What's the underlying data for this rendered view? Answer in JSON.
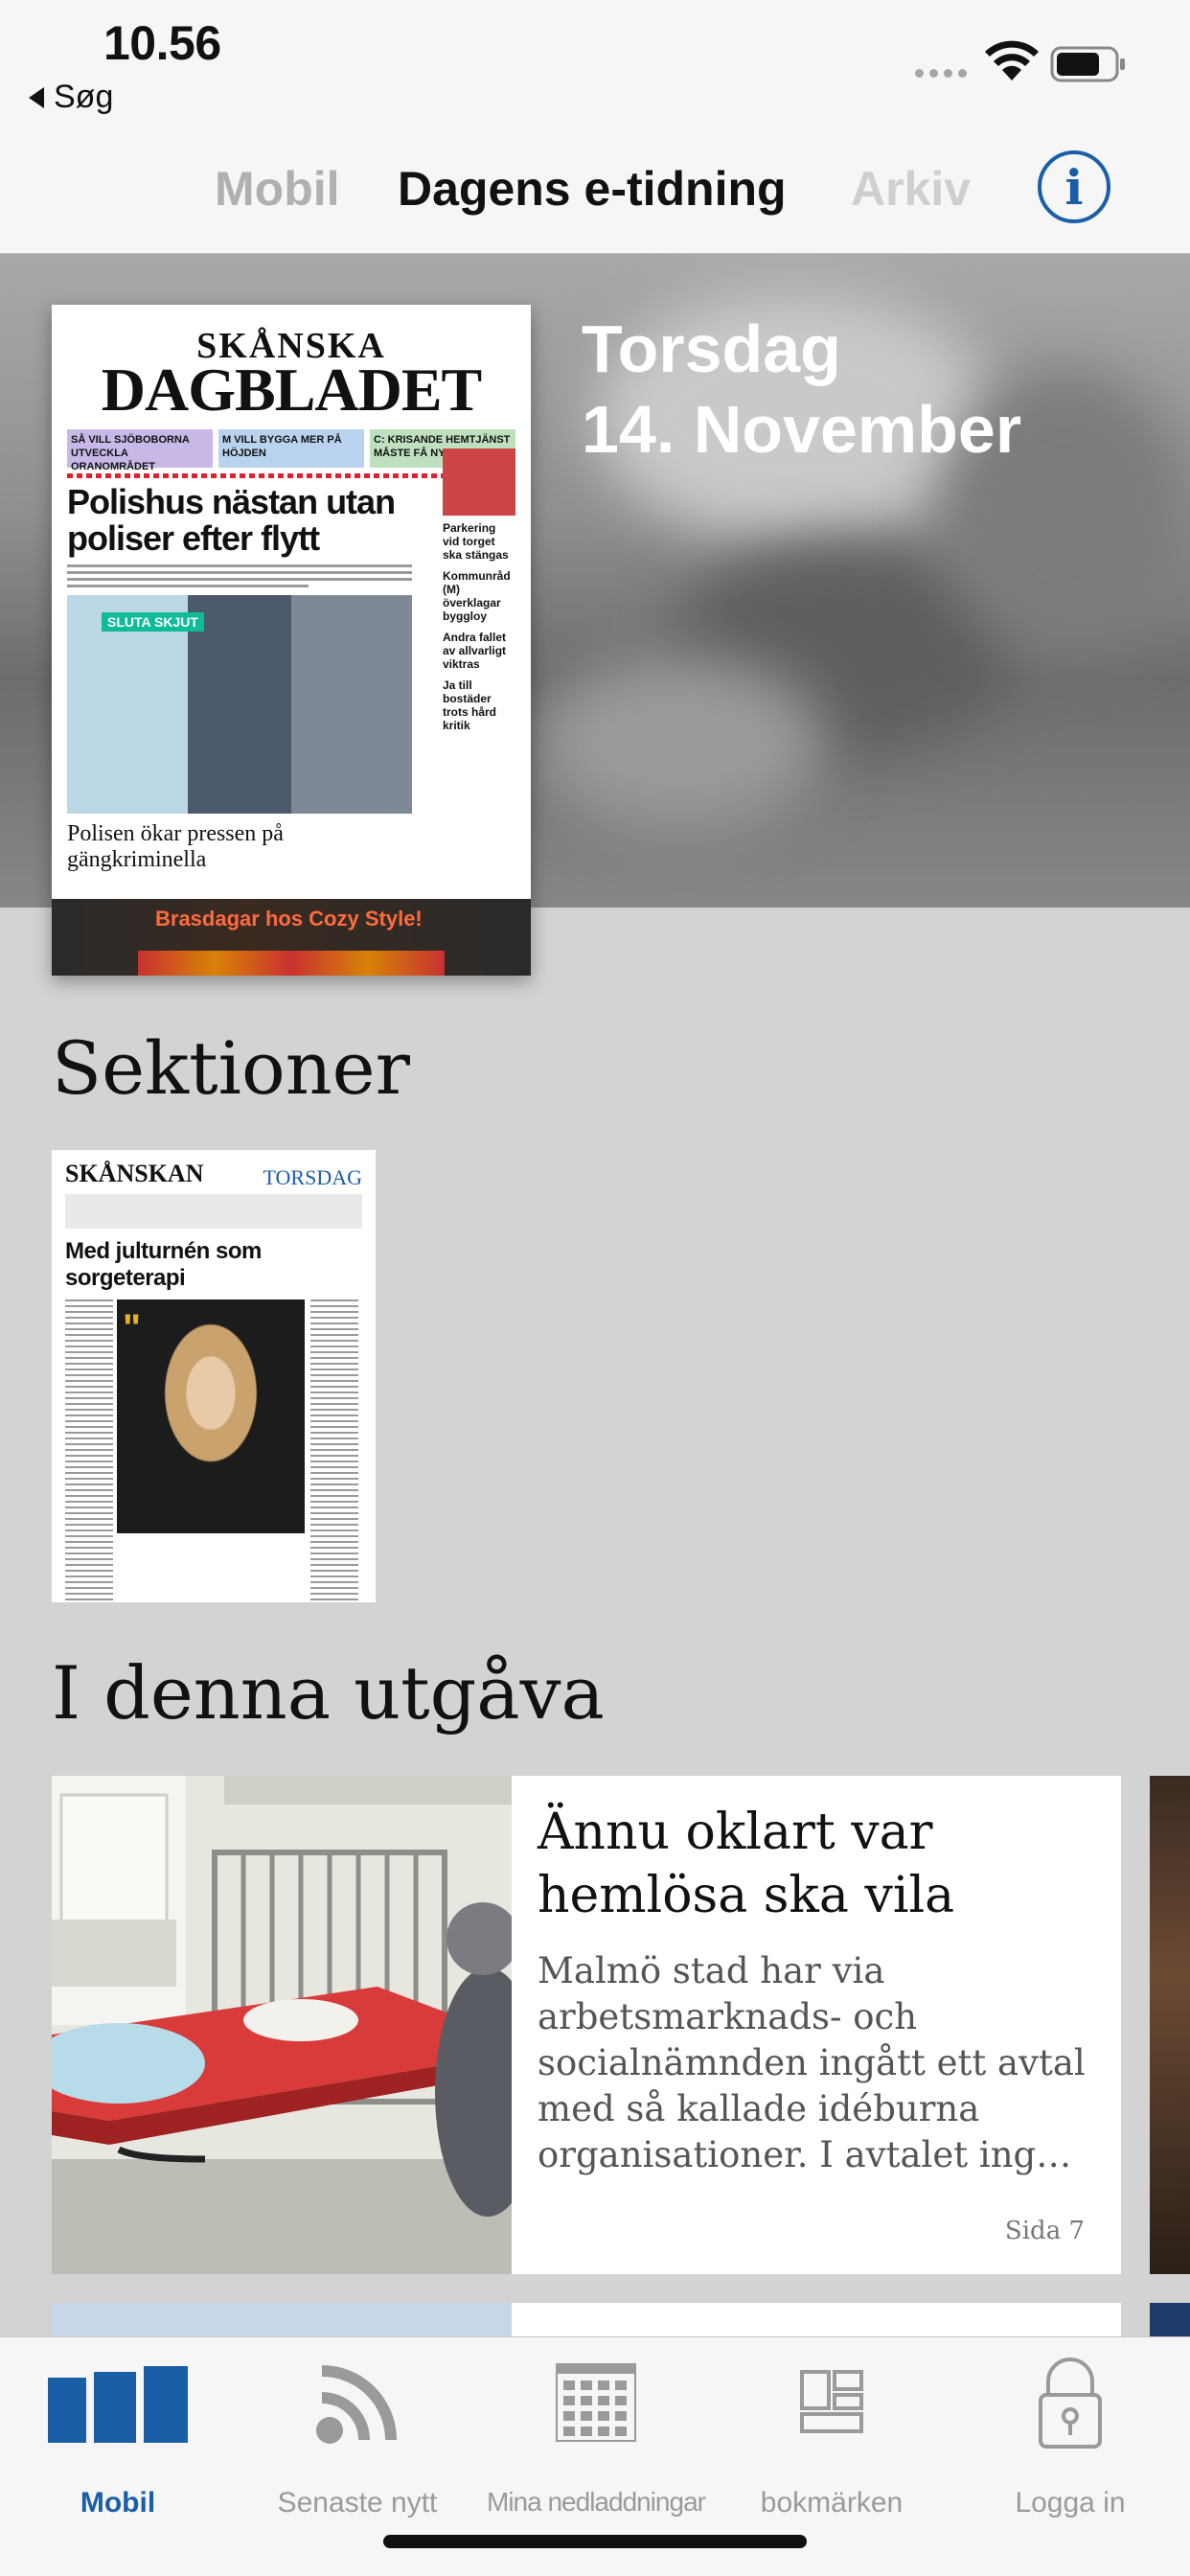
{
  "status_bar": {
    "time": "10.56",
    "back_app": "Søg"
  },
  "top_tabs": {
    "items": [
      {
        "label": "Mobil",
        "selected": false
      },
      {
        "label": "Dagens e-tidning",
        "selected": true
      },
      {
        "label": "Arkiv",
        "selected": false
      }
    ],
    "info_icon": "info-icon"
  },
  "hero": {
    "day": "Torsdag",
    "date": "14. November",
    "frontpage": {
      "masthead_line1": "SKÅNSKA",
      "masthead_line2": "DAGBLADET",
      "teasers": [
        "SÅ VILL SJÖBOBORNA UTVECKLA ORANOMRÅDET",
        "M VILL BYGGA MER PÅ HÖJDEN",
        "C: KRISANDE HEMTJÄNST MÅSTE FÅ NYA MILJONER"
      ],
      "headline": "Polishus nästan utan poliser efter flytt",
      "photo_sign": "SLUTA SKJUT",
      "subhead": "Polisen ökar pressen på gängkriminella",
      "side_items": [
        "Parkering vid torget ska stängas",
        "Kommunråd (M) överklagar byggloy",
        "Andra fallet av allvarligt viktras",
        "Ja till bostäder trots hård kritik"
      ],
      "ad_text": "Brasdagar hos Cozy Style!"
    }
  },
  "sections": {
    "heading": "Sektioner",
    "items": [
      {
        "masthead": "SKÅNSKAN",
        "tag": "TORSDAG",
        "headline": "Med julturnén som sorgeterapi"
      }
    ]
  },
  "issue": {
    "heading": "I denna utgåva",
    "articles": [
      {
        "title": "Ännu oklart var hemlösa ska vila",
        "summary": "Malmö stad har via arbetsmarknads- och socialnämnden ingått ett avtal med så kallade idéburna organisationer. I avtalet ing…",
        "page": "Sida 7"
      }
    ]
  },
  "bottom_tabs": [
    {
      "label": "Mobil",
      "icon": "newspaper-columns-icon",
      "active": true
    },
    {
      "label": "Senaste nytt",
      "icon": "rss-feed-icon",
      "active": false
    },
    {
      "label": "Mina nedladdningar",
      "icon": "downloads-grid-icon",
      "active": false
    },
    {
      "label": "bokmärken",
      "icon": "bookmarks-layout-icon",
      "active": false
    },
    {
      "label": "Logga in",
      "icon": "lock-icon",
      "active": false
    }
  ],
  "colors": {
    "accent": "#1a5ea8",
    "inactive": "#9a9a9a",
    "background": "#d3d3d3"
  }
}
